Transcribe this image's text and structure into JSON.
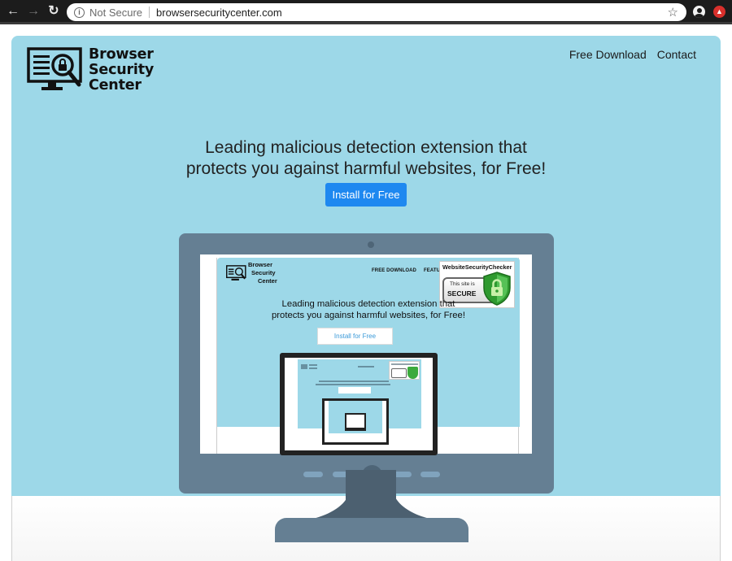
{
  "browser": {
    "back_icon": "arrow-left",
    "forward_icon": "arrow-right",
    "reload_icon": "reload",
    "security_label": "Not Secure",
    "url": "browsersecuritycenter.com",
    "bookmark_icon": "star",
    "profile_icon": "account-circle",
    "extension_icon": "red-upload-circle"
  },
  "site": {
    "logo_lines": [
      "Browser",
      "Security",
      "Center"
    ],
    "nav": [
      "Free Download",
      "Contact"
    ],
    "headline_line1": "Leading malicious detection extension that",
    "headline_line2": "protects you against harmful websites, for Free!",
    "cta_label": "Install for Free",
    "colors": {
      "hero_bg": "#9dd8e8",
      "cta_bg": "#1e88f0",
      "monitor": "#657f93",
      "monitor_dark": "#4c6070"
    }
  },
  "preview": {
    "logo_lines": [
      "Browser",
      "Security",
      "Center"
    ],
    "nav": [
      "FREE DOWNLOAD",
      "FEATU"
    ],
    "badge_title": "WebsiteSecurityChecker",
    "badge_small": "This site is",
    "badge_secure": "SECURE",
    "headline_line1": "Leading malicious detection extension that",
    "headline_line2": "protects you against harmful websites, for Free!",
    "cta_label": "Install for Free"
  }
}
